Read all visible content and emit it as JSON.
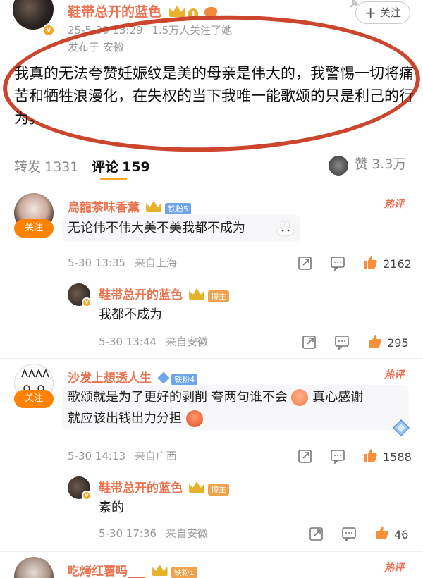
{
  "post": {
    "author": "鞋带总开的蓝色",
    "level_badge": "I",
    "timestamp": "25-5-30 13:29",
    "followers_note": "1.5万人关注了她",
    "location": "发布于 安徽",
    "follow_label": "关注",
    "text": "我真的无法夸赞妊娠纹是美的母亲是伟大的，我警惕一切将痛苦和牺牲浪漫化，在失权的当下我唯一能歌颂的只是利己的行为。"
  },
  "tabs": {
    "repost_label": "转发",
    "repost_count": "1331",
    "comment_label": "评论",
    "comment_count": "159",
    "like_label": "赞",
    "like_count": "3.3万"
  },
  "comments": [
    {
      "user": "烏龍茶味香薫",
      "fan_badge": "铁粉5",
      "follow_label": "关注",
      "hot_label": "热评",
      "text": "无论伟不伟大美不美我都不成为",
      "time": "5-30 13:35",
      "location": "来自上海",
      "likes": "2162",
      "reply": {
        "user": "鞋带总开的蓝色",
        "badge": "博主",
        "text": "我都不成为",
        "time": "5-30 13:44",
        "location": "来自安徽",
        "likes": "295"
      }
    },
    {
      "user": "沙发上想透人生",
      "fan_badge": "铁粉4",
      "follow_label": "关注",
      "hot_label": "热评",
      "text_line1": "歌颂就是为了更好的剥削 夸两句谁不会",
      "text_line1b": "真心感谢",
      "text_line2": "就应该出钱出力分担",
      "time": "5-30 14:13",
      "location": "来自广西",
      "likes": "1588",
      "reply": {
        "user": "鞋带总开的蓝色",
        "badge": "博主",
        "text": "素的",
        "time": "5-30 17:36",
        "location": "来自安徽",
        "likes": "46"
      }
    },
    {
      "user": "吃烤红薯吗___",
      "fan_badge": "铁粉1",
      "hot_label": "热评"
    }
  ],
  "colors": {
    "accent_orange": "#eb7350",
    "follow_orange": "#ff8200",
    "annotation_red": "#c8361c"
  }
}
